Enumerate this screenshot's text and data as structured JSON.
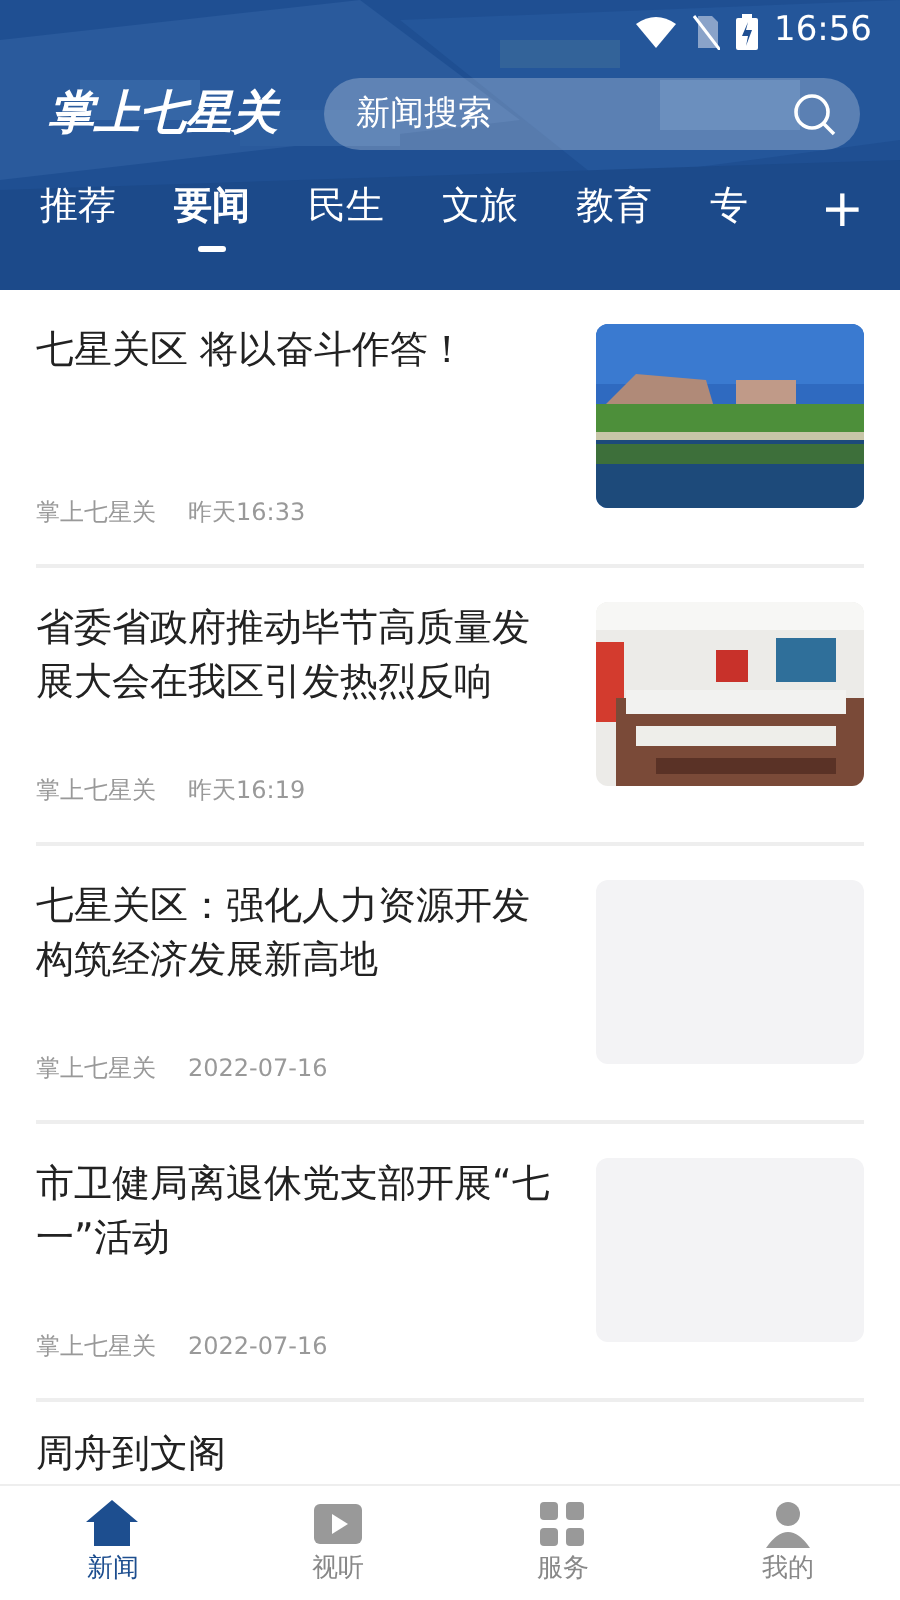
{
  "status_bar": {
    "time": "16:56"
  },
  "header": {
    "logo": "掌上七星关",
    "search": {
      "placeholder": "新闻搜索"
    }
  },
  "tabs": [
    {
      "label": "推荐",
      "selected": false
    },
    {
      "label": "要闻",
      "selected": true
    },
    {
      "label": "民生",
      "selected": false
    },
    {
      "label": "文旅",
      "selected": false
    },
    {
      "label": "教育",
      "selected": false
    },
    {
      "label": "专",
      "selected": false
    }
  ],
  "add_tab": "+",
  "news": [
    {
      "title": "七星关区 将以奋斗作答！",
      "source": "掌上七星关",
      "time": "昨天16:33",
      "kind": "picture"
    },
    {
      "title": "省委省政府推动毕节高质量发展大会在我区引发热烈反响",
      "source": "掌上七星关",
      "time": "昨天16:19",
      "kind": "picture"
    },
    {
      "title": "七星关区：强化人力资源开发构筑经济发展新高地",
      "source": "掌上七星关",
      "time": "2022-07-16",
      "kind": "placeholder"
    },
    {
      "title": "市卫健局离退休党支部开展“七一”活动",
      "source": "掌上七星关",
      "time": "2022-07-16",
      "kind": "placeholder"
    },
    {
      "title": "周舟到文阁",
      "kind": "partial"
    }
  ],
  "bottom_nav": [
    {
      "label": "新闻",
      "selected": true
    },
    {
      "label": "视听",
      "selected": false
    },
    {
      "label": "服务",
      "selected": false
    },
    {
      "label": "我的",
      "selected": false
    }
  ]
}
